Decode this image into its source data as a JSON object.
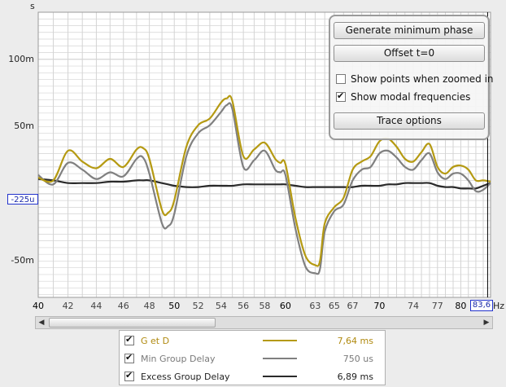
{
  "colors": {
    "plot_bg": "#ffffff",
    "grid": "#d4d4d4",
    "accent": "#b59a12",
    "gd_trace": "#b59a12",
    "min_trace": "#808080",
    "excess_trace": "#2a2a2a",
    "cursor": "#2233cc"
  },
  "axis": {
    "y_unit": "s",
    "x_unit": "Hz",
    "y_ticks": [
      {
        "value": 0.1,
        "label": "100m"
      },
      {
        "value": 0.05,
        "label": "50m"
      },
      {
        "value": -0.05,
        "label": "-50m"
      }
    ],
    "x_ticks": [
      {
        "value": 40,
        "label": "40",
        "major": true
      },
      {
        "value": 42,
        "label": "42",
        "major": false
      },
      {
        "value": 44,
        "label": "44",
        "major": false
      },
      {
        "value": 46,
        "label": "46",
        "major": false
      },
      {
        "value": 48,
        "label": "48",
        "major": false
      },
      {
        "value": 50,
        "label": "50",
        "major": true
      },
      {
        "value": 52,
        "label": "52",
        "major": false
      },
      {
        "value": 54,
        "label": "54",
        "major": false
      },
      {
        "value": 56,
        "label": "56",
        "major": false
      },
      {
        "value": 58,
        "label": "58",
        "major": false
      },
      {
        "value": 60,
        "label": "60",
        "major": true
      },
      {
        "value": 63,
        "label": "63",
        "major": false
      },
      {
        "value": 65,
        "label": "65",
        "major": false
      },
      {
        "value": 67,
        "label": "67",
        "major": false
      },
      {
        "value": 70,
        "label": "70",
        "major": true
      },
      {
        "value": 74,
        "label": "74",
        "major": false
      },
      {
        "value": 77,
        "label": "77",
        "major": false
      },
      {
        "value": 80,
        "label": "80",
        "major": true
      }
    ],
    "cursor_y_label": "-225u",
    "cursor_x_label": "83,6"
  },
  "chart_data": {
    "type": "line",
    "x_scale": "log",
    "xlim": [
      40,
      84
    ],
    "ylim": [
      -0.077,
      0.135
    ],
    "grid": true,
    "x": [
      40,
      41,
      42,
      43,
      44,
      45,
      46,
      47,
      47.5,
      48,
      49,
      49.5,
      50,
      51,
      52,
      53,
      54,
      54.5,
      55,
      56,
      57,
      58,
      59,
      59.5,
      60,
      61,
      62,
      63,
      63.5,
      64,
      65,
      66,
      67,
      68,
      69,
      70,
      71,
      72,
      73,
      74,
      75,
      76,
      77,
      78,
      79,
      80,
      81,
      82,
      83,
      84
    ],
    "series": [
      {
        "name": "G et D",
        "values": [
          0.012,
          0.01,
          0.032,
          0.024,
          0.019,
          0.026,
          0.02,
          0.033,
          0.034,
          0.026,
          -0.012,
          -0.014,
          -0.005,
          0.035,
          0.051,
          0.056,
          0.068,
          0.071,
          0.069,
          0.028,
          0.033,
          0.038,
          0.026,
          0.023,
          0.022,
          -0.018,
          -0.046,
          -0.053,
          -0.05,
          -0.022,
          -0.01,
          -0.003,
          0.018,
          0.024,
          0.028,
          0.039,
          0.041,
          0.035,
          0.026,
          0.024,
          0.031,
          0.037,
          0.02,
          0.015,
          0.02,
          0.021,
          0.018,
          0.01,
          0.01,
          0.009
        ]
      },
      {
        "name": "Min Group Delay",
        "values": [
          0.014,
          0.007,
          0.023,
          0.018,
          0.011,
          0.016,
          0.013,
          0.026,
          0.027,
          0.015,
          -0.022,
          -0.024,
          -0.015,
          0.028,
          0.045,
          0.051,
          0.061,
          0.066,
          0.063,
          0.02,
          0.025,
          0.032,
          0.018,
          0.016,
          0.014,
          -0.026,
          -0.054,
          -0.059,
          -0.056,
          -0.028,
          -0.013,
          -0.008,
          0.01,
          0.018,
          0.02,
          0.03,
          0.032,
          0.027,
          0.02,
          0.018,
          0.025,
          0.03,
          0.016,
          0.011,
          0.015,
          0.015,
          0.01,
          0.002,
          0.003,
          0.008
        ]
      },
      {
        "name": "Excess Group Delay",
        "values": [
          0.011,
          0.01,
          0.008,
          0.008,
          0.008,
          0.009,
          0.009,
          0.01,
          0.01,
          0.01,
          0.008,
          0.007,
          0.006,
          0.005,
          0.005,
          0.006,
          0.006,
          0.006,
          0.006,
          0.007,
          0.007,
          0.007,
          0.007,
          0.007,
          0.007,
          0.006,
          0.005,
          0.005,
          0.005,
          0.005,
          0.005,
          0.005,
          0.005,
          0.006,
          0.006,
          0.006,
          0.007,
          0.007,
          0.008,
          0.008,
          0.008,
          0.008,
          0.006,
          0.005,
          0.005,
          0.004,
          0.004,
          0.004,
          0.006,
          0.008
        ]
      }
    ]
  },
  "overlay_panel": {
    "generate_min_phase": "Generate minimum phase",
    "offset": "Offset t=0",
    "show_points": {
      "label": "Show points when zoomed in",
      "checked": false
    },
    "show_modal": {
      "label": "Show modal frequencies",
      "checked": true
    },
    "trace_options": "Trace options"
  },
  "legend": [
    {
      "name": "G et D",
      "value": "7,64 ms",
      "checked": true,
      "color": "#b59a12",
      "text_color": "#b08a10"
    },
    {
      "name": "Min Group Delay",
      "value": "750 us",
      "checked": true,
      "color": "#808080",
      "text_color": "#7a7a7a"
    },
    {
      "name": "Excess Group Delay",
      "value": "6,89 ms",
      "checked": true,
      "color": "#2a2a2a",
      "text_color": "#222222"
    }
  ],
  "scrollbar": {
    "left_icon": "arrow-left-icon",
    "right_icon": "arrow-right-icon"
  }
}
